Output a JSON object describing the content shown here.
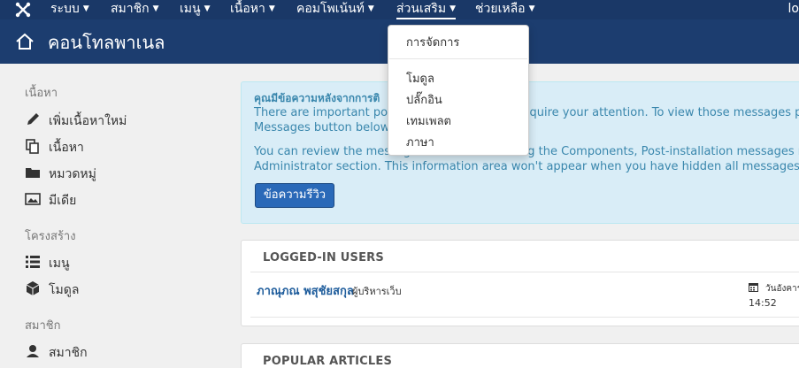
{
  "navbar": {
    "items": [
      {
        "label": "ระบบ"
      },
      {
        "label": "สมาชิก"
      },
      {
        "label": "เมนู"
      },
      {
        "label": "เนื้อหา"
      },
      {
        "label": "คอมโพเน้นท์"
      },
      {
        "label": "ส่วนเสริม"
      },
      {
        "label": "ช่วยเหลือ"
      }
    ],
    "truncated_right": "lo"
  },
  "header": {
    "title": "คอนโทลพาเนล"
  },
  "sidebar": {
    "sections": [
      {
        "heading": "เนื้อหา",
        "items": [
          {
            "label": "เพิ่มเนื้อหาใหม่",
            "icon": "pencil-icon"
          },
          {
            "label": "เนื้อหา",
            "icon": "copy-icon"
          },
          {
            "label": "หมวดหมู่",
            "icon": "folder-icon"
          },
          {
            "label": "มีเดีย",
            "icon": "image-icon"
          }
        ]
      },
      {
        "heading": "โครงสร้าง",
        "items": [
          {
            "label": "เมนู",
            "icon": "list-icon"
          },
          {
            "label": "โมดูล",
            "icon": "cube-icon"
          }
        ]
      },
      {
        "heading": "สมาชิก",
        "items": [
          {
            "label": "สมาชิก",
            "icon": "user-icon"
          }
        ]
      }
    ]
  },
  "alert": {
    "title": "คุณมีข้อความหลังจากการติ",
    "p1_text": "There are important post-i                                equire your attention. To view those messages please",
    "p1_line2": "Messages button below.",
    "p2_line1": "You can review the messag                                g the Components, Post-installation messages menu",
    "p2_line2": "Administrator section. This information area won't appear when you have hidden all messages.",
    "button_label": "ข้อความรีวิว"
  },
  "logged_in": {
    "heading": "LOGGED-IN USERS",
    "user_name": "ภาณุภณ พสุชัยสกุล",
    "user_role": "ผู้บริหารเว็บ",
    "date": "วันอังคาร",
    "time": "14:52"
  },
  "popular": {
    "heading": "POPULAR ARTICLES"
  },
  "dropdown": {
    "manage": "การจัดการ",
    "items": [
      "โมดูล",
      "ปลั๊กอิน",
      "เทมเพลต",
      "ภาษา"
    ]
  },
  "colors": {
    "navbar": "#1a3867",
    "header": "#1c3d6f",
    "link": "#1f5d9c",
    "button": "#2a69b8"
  }
}
